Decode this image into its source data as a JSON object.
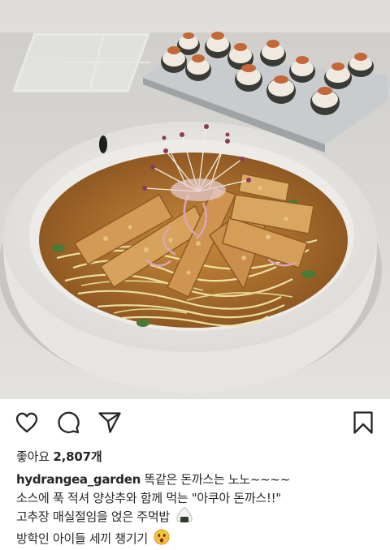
{
  "post": {
    "image_alt": "",
    "likes_label": "좋아요",
    "likes_count": "2,807개",
    "username": "hydrangea_garden",
    "caption_lines": [
      "똑같은 돈까스는 노노~~~~",
      "소스에 푹 적셔 양상추와 함께 먹는 \"아쿠아 돈까스!!\"",
      "고추장 매실절임을  얹은 주먹밥",
      "방학인 아이들 세끼 챙기기"
    ]
  },
  "icons": {
    "like": "heart-icon",
    "comment": "comment-bubble-icon",
    "share": "paper-plane-icon",
    "save": "bookmark-icon",
    "rice_ball": "rice-ball-emoji",
    "face": "astonished-face-emoji"
  },
  "colors": {
    "text": "#262626",
    "icon_stroke": "#262626",
    "background": "#ffffff"
  }
}
